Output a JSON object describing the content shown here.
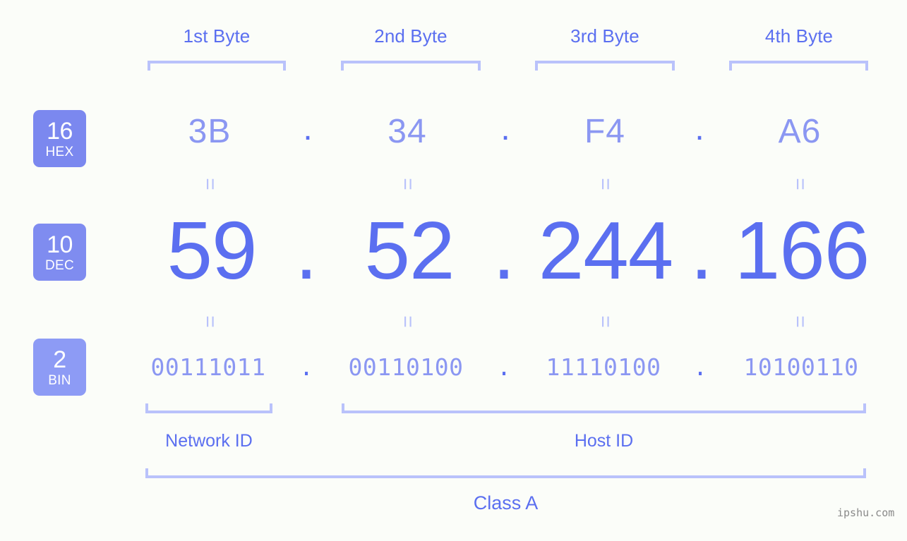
{
  "meta": {
    "background_color": "#fbfdf9",
    "accent_color": "#5b6ff0",
    "accent_light_color": "#8b97f2",
    "bracket_color": "#b9c2fb",
    "badge_color_hex": "#7b88ef",
    "badge_color_dec": "#7f8cf0",
    "badge_color_bin": "#8d9bf5",
    "watermark": "ipshu.com"
  },
  "byte_headers": [
    {
      "label": "1st Byte"
    },
    {
      "label": "2nd Byte"
    },
    {
      "label": "3rd Byte"
    },
    {
      "label": "4th Byte"
    }
  ],
  "rows": [
    {
      "badge": {
        "base": "16",
        "name": "HEX"
      },
      "values": [
        "3B",
        "34",
        "F4",
        "A6"
      ],
      "separator": "."
    },
    {
      "badge": {
        "base": "10",
        "name": "DEC"
      },
      "values": [
        "59",
        "52",
        "244",
        "166"
      ],
      "separator": "."
    },
    {
      "badge": {
        "base": "2",
        "name": "BIN"
      },
      "values": [
        "00111011",
        "00110100",
        "11110100",
        "10100110"
      ],
      "separator": "."
    }
  ],
  "equals_glyph": "=",
  "sections": {
    "network_id": "Network ID",
    "host_id": "Host ID",
    "class": "Class A"
  }
}
